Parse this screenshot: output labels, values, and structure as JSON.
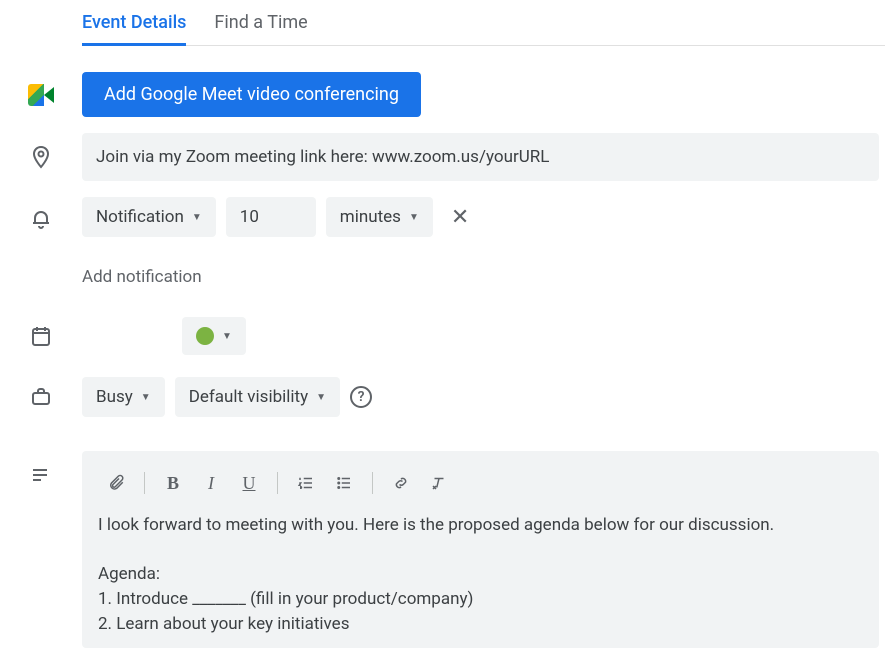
{
  "tabs": {
    "event_details": "Event Details",
    "find_time": "Find a Time"
  },
  "meet": {
    "button_label": "Add Google Meet video conferencing"
  },
  "location": {
    "value": "Join via my Zoom meeting link here: www.zoom.us/yourURL"
  },
  "notification": {
    "type_label": "Notification",
    "value": "10",
    "unit_label": "minutes",
    "add_label": "Add notification"
  },
  "calendar": {
    "color": "#7cb342"
  },
  "availability": {
    "busy_label": "Busy",
    "visibility_label": "Default visibility"
  },
  "description": {
    "text": "I look forward to meeting with you. Here is the proposed agenda below for our discussion.\n\nAgenda:\n1. Introduce _______ (fill in your product/company)\n2. Learn about your key initiatives"
  }
}
